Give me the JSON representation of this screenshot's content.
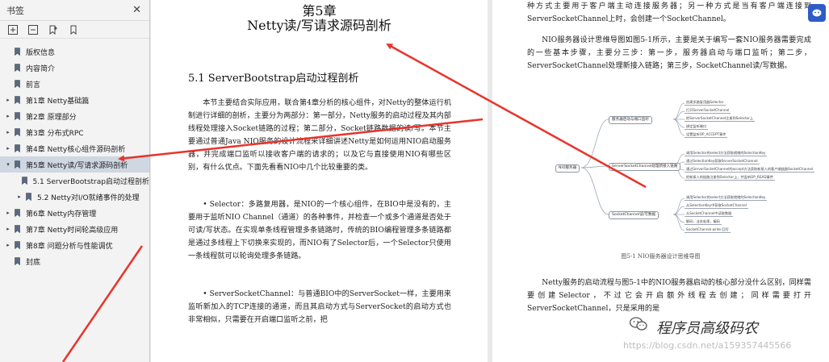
{
  "sidebar": {
    "title": "书签",
    "close": "✕",
    "tools": [
      "expand-all-icon",
      "collapse-all-icon",
      "bookmark-add-icon",
      "bookmark-icon"
    ],
    "items": [
      {
        "label": "版权信息",
        "level": 0,
        "caret": ""
      },
      {
        "label": "内容简介",
        "level": 0,
        "caret": "",
        "hover": true
      },
      {
        "label": "前言",
        "level": 0,
        "caret": ""
      },
      {
        "label": "第1章 Netty基础篇",
        "level": 0,
        "caret": "▸"
      },
      {
        "label": "第2章 原理部分",
        "level": 0,
        "caret": "▸"
      },
      {
        "label": "第3章 分布式RPC",
        "level": 0,
        "caret": "▸"
      },
      {
        "label": "第4章 Netty核心组件源码剖析",
        "level": 0,
        "caret": "▸"
      },
      {
        "label": "第5章 Netty读/写请求源码剖析",
        "level": 0,
        "caret": "▾",
        "selected": true
      },
      {
        "label": "5.1 ServerBootstrap启动过程剖析",
        "level": 1,
        "caret": ""
      },
      {
        "label": "5.2 Netty对I/O就绪事件的处理",
        "level": 1,
        "caret": "▸"
      },
      {
        "label": "第6章 Netty内存管理",
        "level": 0,
        "caret": "▸"
      },
      {
        "label": "第7章 Netty时间轮高级应用",
        "level": 0,
        "caret": "▸"
      },
      {
        "label": "第8章 问题分析与性能调优",
        "level": 0,
        "caret": "▸"
      },
      {
        "label": "封底",
        "level": 0,
        "caret": ""
      }
    ]
  },
  "page1": {
    "chapter_label": "第5章",
    "chapter_title": "Netty读/写请求源码剖析",
    "section_title": "5.1   ServerBootstrap启动过程剖析",
    "p1": "本节主要结合实际应用，联合第4章分析的核心组件，对Netty的整体运行机制进行详细的剖析，主要分为两部分：第一部分，Netty服务的启动过程及其内部线程处理接入Socket链路的过程；第二部分，Socket链路数据的读/写。本节主要通过普通Java NIO服务的设计流程来详细讲述Netty是如何运用NIO启动服务器，并完成端口监听以接收客户端的请求的；以及它与直接使用NIO有哪些区别，有什么优点。下面先看看NIO中几个比较重要的类。",
    "p2": "• Selector：多路复用器，是NIO的一个核心组件，在BIO中是没有的，主要用于监听NIO Channel（通道）的各种事件，并检查一个或多个通道是否处于可读/写状态。在实现单条线程管理多条链路时，传统的BIO编程管理多条链路都是通过多线程上下切换来实现的，而NIO有了Selector后，一个Selector只使用一条线程就可以轮询处理多条链路。",
    "p3": "• ServerSocketChannel：与普通BIO中的ServerSocket一样，主要用来监听新加入的TCP连接的通道，而且其启动方式与ServerSocket的启动方式也非常相似，只需要在开启端口监听之前，把"
  },
  "page2": {
    "top": "种方式主要用于客户端主动连接服务器；另一种方式是当有客户端连接到ServerSocketChannel上时，会创建一个SocketChannel。",
    "pa": "NIO服务器设计思维导图如图5-1所示，主要是关于编写一套NIO服务器需要完成的一些基本步骤，主要分三步：第一步，服务器启动与端口监听；第二步，ServerSocketChannel处理新接入链路；第三步，SocketChannel读/写数据。",
    "fig_caption": "图5-1   NIO服务器设计思维导图",
    "pb": "Netty服务的启动流程与图5-1中的NIO服务器启动的核心部分没什么区别，同样需要创建Selector，不过它会开启额外线程去创建；同样需要打开ServerSocketChannel，只是采用的是",
    "mindmap": {
      "root": "NIO服务器",
      "branches": [
        {
          "label": "服务器启动与端口监听",
          "leaves": [
            "创建多路复用器Selector",
            "打开ServerSocketChannel",
            "把ServerSocketChannel注册到Selector上",
            "绑定监听端口",
            "设置监听OP_ACCEPT事件"
          ]
        },
        {
          "label": "ServerSocketChannel处理新接入链路",
          "leaves": [
            "调用Selector的select方法获取就绪的SelectionKey",
            "通过SelectionKey获取ServerSocketChannel",
            "通过ServerSocketChannel的accept方法获取新接入的客户端链路SocketChannel",
            "把新接入的链路注册到Selector上，并监听OP_READ事件"
          ]
        },
        {
          "label": "SocketChannel读/写数据",
          "leaves": [
            "调用Selector的select方法获取就绪的SelectionKey",
            "从SelectionKey中获取SocketChannel",
            "从SocketChannel中读取数据",
            "解码，业务处理，编码",
            "SocketChannel.write 回写"
          ]
        }
      ]
    }
  },
  "watermark": {
    "brand": "程序员高级码农",
    "url": "https://blog.csdn.net/a159357445566"
  },
  "colors": {
    "arrow": "#e8342c",
    "badge": "#2f5bc7",
    "selected": "#cfd7e3"
  }
}
